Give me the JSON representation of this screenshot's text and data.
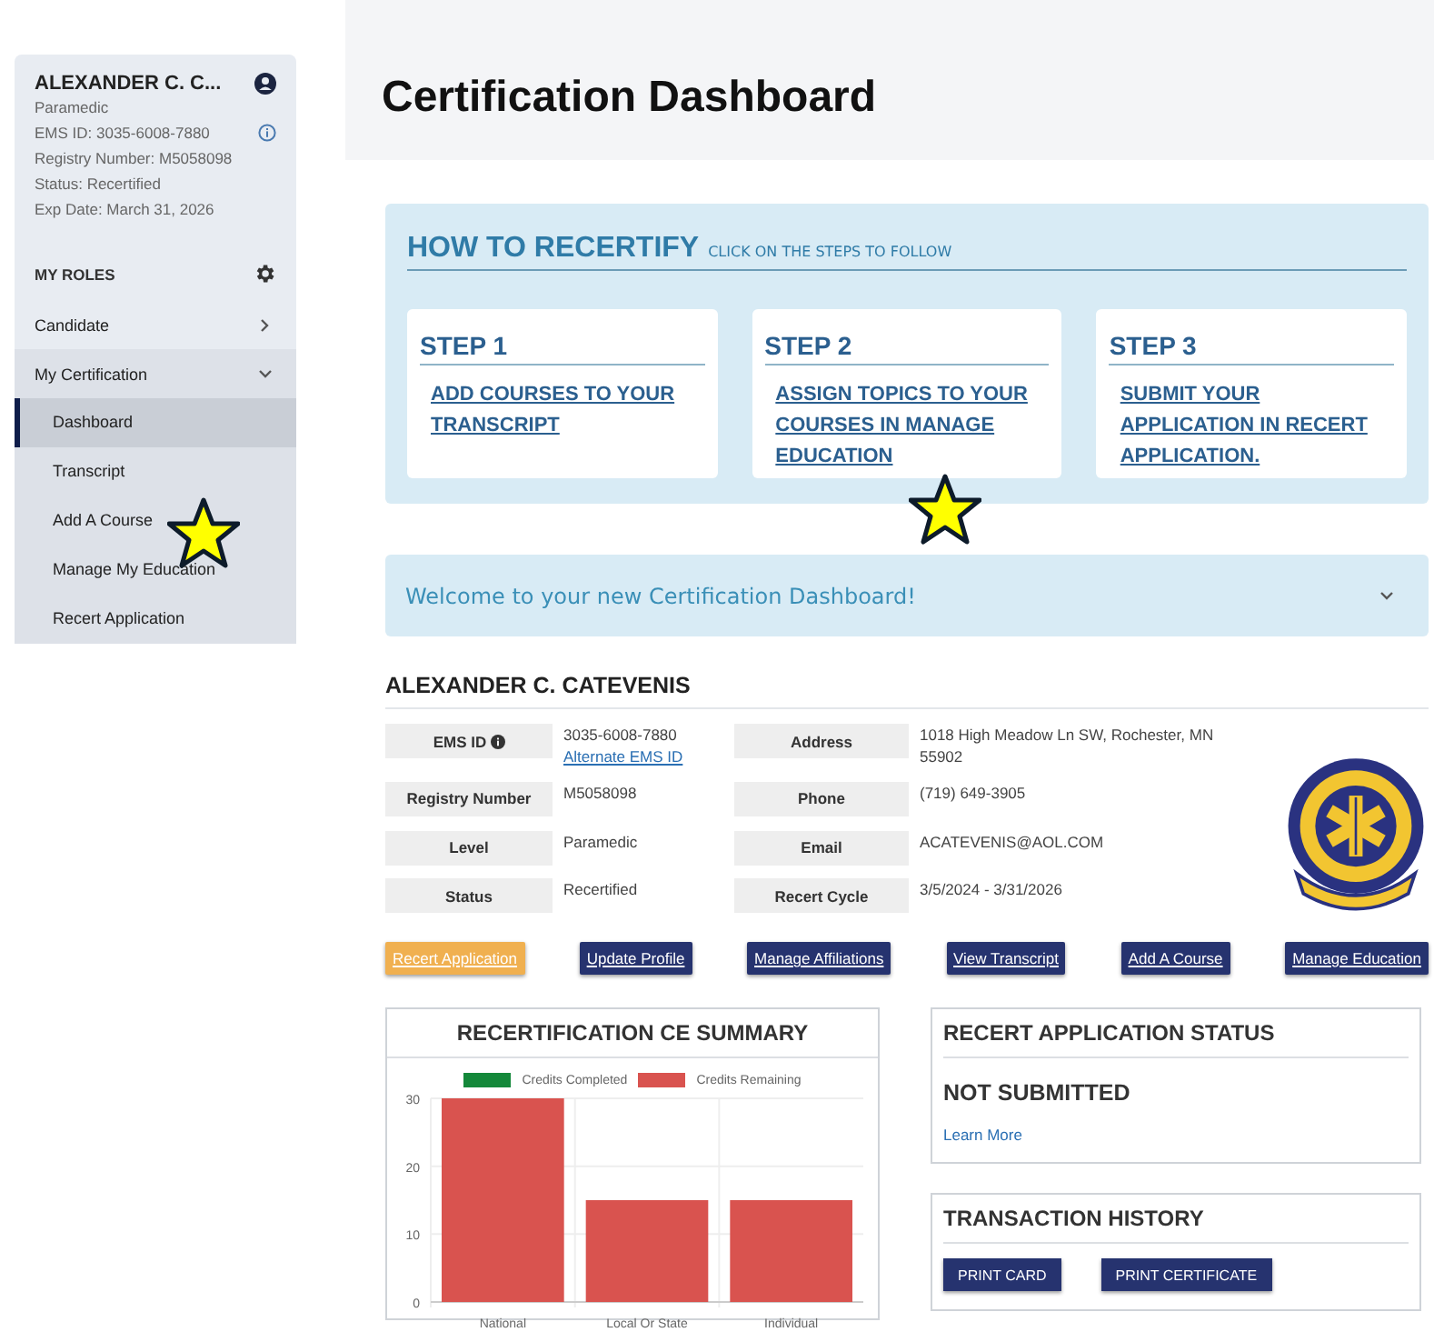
{
  "sidebar": {
    "name": "ALEXANDER C. C...",
    "lines": [
      "Paramedic",
      "EMS ID: 3035-6008-7880",
      "Registry Number: M5058098",
      "Status: Recertified",
      "Exp Date: March 31, 2026"
    ],
    "roles_heading": "MY ROLES",
    "items": [
      {
        "label": "Candidate",
        "expanded": false
      },
      {
        "label": "My Certification",
        "expanded": true,
        "children": [
          {
            "label": "Dashboard",
            "selected": true
          },
          {
            "label": "Transcript",
            "selected": false
          },
          {
            "label": "Add A Course",
            "selected": false
          },
          {
            "label": "Manage My Education",
            "selected": false
          },
          {
            "label": "Recert Application",
            "selected": false
          }
        ]
      }
    ]
  },
  "page_title": "Certification Dashboard",
  "how_to": {
    "title": "HOW TO RECERTIFY",
    "subtitle": "CLICK ON THE STEPS TO FOLLOW",
    "steps": [
      {
        "title": "STEP 1",
        "link": "ADD COURSES TO YOUR TRANSCRIPT"
      },
      {
        "title": "STEP 2",
        "link": "ASSIGN TOPICS TO YOUR COURSES IN MANAGE EDUCATION"
      },
      {
        "title": "STEP 3",
        "link": "SUBMIT YOUR APPLICATION IN RECERT APPLICATION."
      }
    ]
  },
  "welcome": {
    "text": "Welcome to your new Certification Dashboard!",
    "expanded": false
  },
  "profile": {
    "name": "ALEXANDER C. CATEVENIS",
    "details": [
      {
        "label": "EMS ID",
        "info": true,
        "value": "3035-6008-7880",
        "link": "Alternate EMS ID"
      },
      {
        "label": "Address",
        "info": false,
        "value": "1018 High Meadow Ln SW, Rochester, MN 55902"
      },
      {
        "label": "Registry Number",
        "info": false,
        "value": "M5058098"
      },
      {
        "label": "Phone",
        "info": false,
        "value": "(719) 649-3905"
      },
      {
        "label": "Level",
        "info": false,
        "value": "Paramedic"
      },
      {
        "label": "Email",
        "info": false,
        "value": "ACATEVENIS@AOL.COM"
      },
      {
        "label": "Status",
        "info": false,
        "value": "Recertified"
      },
      {
        "label": "Recert Cycle",
        "info": false,
        "value": "3/5/2024 - 3/31/2026"
      }
    ],
    "buttons": [
      {
        "label": "Recert Application",
        "kind": "highlight"
      },
      {
        "label": "Update Profile",
        "kind": "primary"
      },
      {
        "label": "Manage Affiliations",
        "kind": "primary"
      },
      {
        "label": "View Transcript",
        "kind": "primary"
      },
      {
        "label": "Add A Course",
        "kind": "primary"
      },
      {
        "label": "Manage Education",
        "kind": "primary"
      }
    ]
  },
  "ce_summary": {
    "title": "RECERTIFICATION CE SUMMARY",
    "chart_data": {
      "type": "bar",
      "categories": [
        "National",
        "Local Or State",
        "Individual"
      ],
      "series": [
        {
          "name": "Credits Completed",
          "color": "#14883a",
          "values": [
            0,
            0,
            0
          ]
        },
        {
          "name": "Credits Remaining",
          "color": "#d9534f",
          "values": [
            30,
            15,
            15
          ]
        }
      ],
      "ylim": [
        0,
        30
      ],
      "yticks": [
        0,
        10,
        20,
        30
      ],
      "stacked": true
    }
  },
  "recert_status": {
    "title": "RECERT APPLICATION STATUS",
    "status": "NOT SUBMITTED",
    "link": "Learn More"
  },
  "transactions": {
    "title": "TRANSACTION HISTORY",
    "buttons": [
      "PRINT CARD",
      "PRINT CERTIFICATE"
    ]
  }
}
